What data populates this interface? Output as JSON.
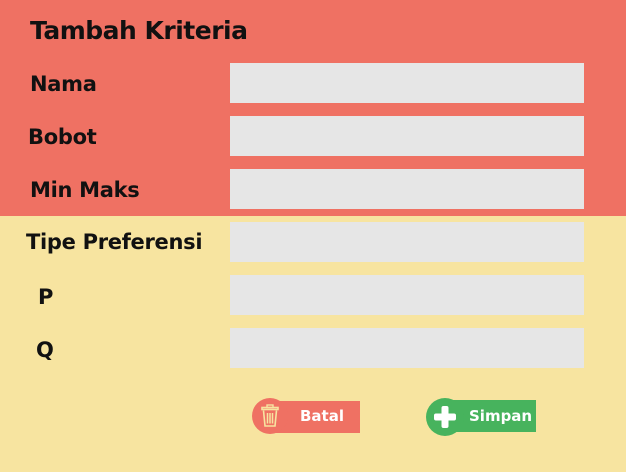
{
  "form": {
    "title": "Tambah Kriteria",
    "fields": [
      {
        "label": "Nama",
        "value": ""
      },
      {
        "label": "Bobot",
        "value": ""
      },
      {
        "label": "Min Maks",
        "value": ""
      },
      {
        "label": "Tipe Preferensi",
        "value": ""
      },
      {
        "label": "P",
        "value": ""
      },
      {
        "label": "Q",
        "value": ""
      }
    ]
  },
  "actions": {
    "cancel_label": "Batal",
    "save_label": "Simpan"
  },
  "colors": {
    "header_bg": "#ef7163",
    "body_bg": "#f7e4a0",
    "field_bg": "#e6e6e6",
    "cancel": "#ef7163",
    "save": "#47b35d"
  },
  "icons": {
    "cancel": "trash-icon",
    "save": "plus-icon"
  }
}
